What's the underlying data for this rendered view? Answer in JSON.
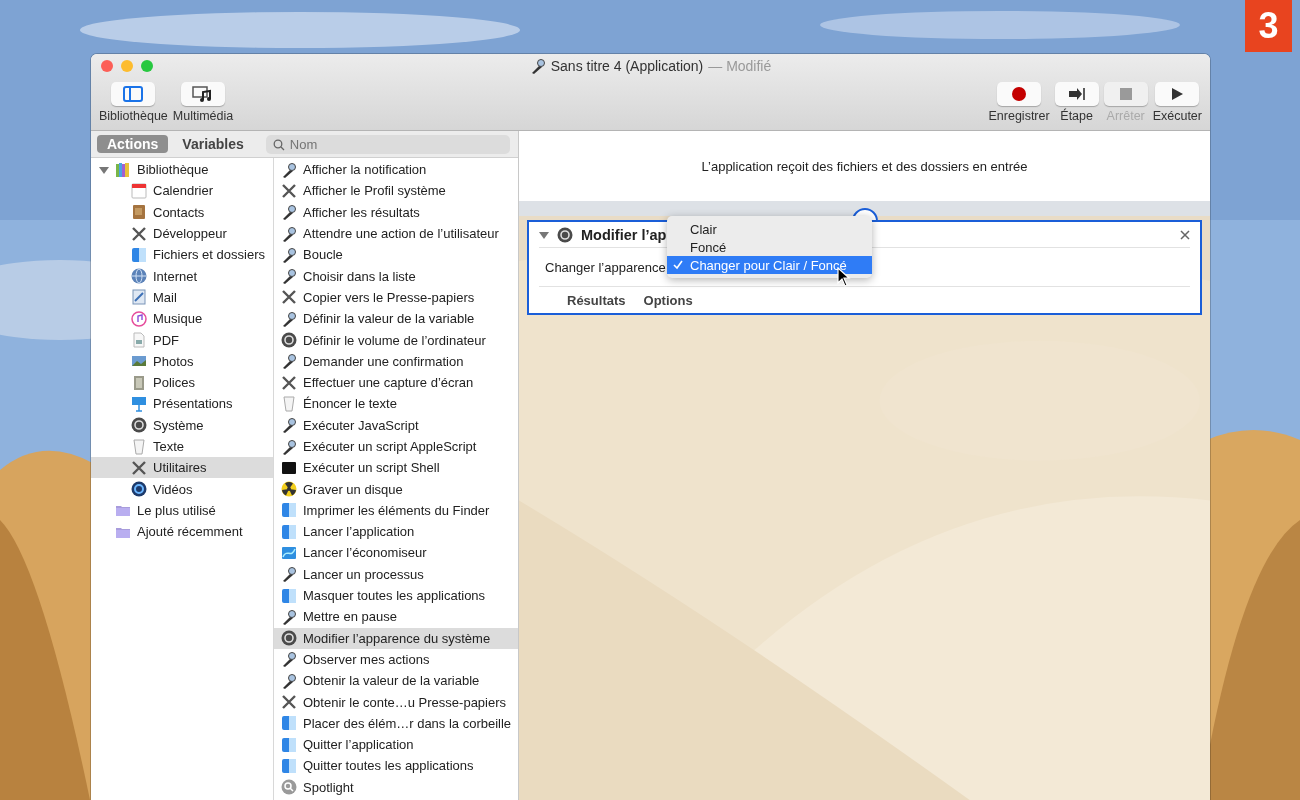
{
  "window": {
    "title": "Sans titre 4 (Application)",
    "title_status": "— Modifié"
  },
  "badge": "3",
  "toolbar_left": [
    {
      "label": "Bibliothèque",
      "kind": "sidebar"
    },
    {
      "label": "Multimédia",
      "kind": "media"
    }
  ],
  "toolbar_right": [
    {
      "label": "Enregistrer",
      "kind": "record",
      "disabled": false
    },
    {
      "label": "Étape",
      "kind": "step",
      "disabled": false
    },
    {
      "label": "Arrêter",
      "kind": "stop",
      "disabled": true
    },
    {
      "label": "Exécuter",
      "kind": "run",
      "disabled": false
    }
  ],
  "tabs": [
    {
      "label": "Actions",
      "selected": true
    },
    {
      "label": "Variables",
      "selected": false
    }
  ],
  "search": {
    "placeholder": "Nom"
  },
  "library": [
    {
      "label": "Bibliothèque",
      "kind": "library",
      "expanded": true,
      "selected": false,
      "children": [
        {
          "label": "Calendrier",
          "kind": "calendar",
          "selected": false
        },
        {
          "label": "Contacts",
          "kind": "contacts",
          "selected": false
        },
        {
          "label": "Développeur",
          "kind": "tools",
          "selected": false
        },
        {
          "label": "Fichiers et dossiers",
          "kind": "finder",
          "selected": false
        },
        {
          "label": "Internet",
          "kind": "internet",
          "selected": false
        },
        {
          "label": "Mail",
          "kind": "mail",
          "selected": false
        },
        {
          "label": "Musique",
          "kind": "music",
          "selected": false
        },
        {
          "label": "PDF",
          "kind": "pdf",
          "selected": false
        },
        {
          "label": "Photos",
          "kind": "photos",
          "selected": false
        },
        {
          "label": "Polices",
          "kind": "fonts",
          "selected": false
        },
        {
          "label": "Présentations",
          "kind": "presentation",
          "selected": false
        },
        {
          "label": "Système",
          "kind": "system",
          "selected": false
        },
        {
          "label": "Texte",
          "kind": "text",
          "selected": false
        },
        {
          "label": "Utilitaires",
          "kind": "tools",
          "selected": true
        },
        {
          "label": "Vidéos",
          "kind": "video",
          "selected": false
        }
      ]
    },
    {
      "label": "Le plus utilisé",
      "kind": "smartfolder",
      "selected": false
    },
    {
      "label": "Ajouté récemment",
      "kind": "smartfolder",
      "selected": false
    }
  ],
  "actions": [
    {
      "label": "Afficher la notification",
      "kind": "automator",
      "selected": false
    },
    {
      "label": "Afficher le Profil système",
      "kind": "tools",
      "selected": false
    },
    {
      "label": "Afficher les résultats",
      "kind": "automator",
      "selected": false
    },
    {
      "label": "Attendre une action de l’utilisateur",
      "kind": "automator",
      "selected": false
    },
    {
      "label": "Boucle",
      "kind": "automator",
      "selected": false
    },
    {
      "label": "Choisir dans la liste",
      "kind": "automator",
      "selected": false
    },
    {
      "label": "Copier vers le Presse-papiers",
      "kind": "tools",
      "selected": false
    },
    {
      "label": "Définir la valeur de la variable",
      "kind": "automator",
      "selected": false
    },
    {
      "label": "Définir le volume de l’ordinateur",
      "kind": "system",
      "selected": false
    },
    {
      "label": "Demander une confirmation",
      "kind": "automator",
      "selected": false
    },
    {
      "label": "Effectuer une capture d’écran",
      "kind": "tools",
      "selected": false
    },
    {
      "label": "Énoncer le texte",
      "kind": "text",
      "selected": false
    },
    {
      "label": "Exécuter JavaScript",
      "kind": "automator",
      "selected": false
    },
    {
      "label": "Exécuter un script AppleScript",
      "kind": "automator",
      "selected": false
    },
    {
      "label": "Exécuter un script Shell",
      "kind": "terminal",
      "selected": false
    },
    {
      "label": "Graver un disque",
      "kind": "burn",
      "selected": false
    },
    {
      "label": "Imprimer les éléments du Finder",
      "kind": "finder",
      "selected": false
    },
    {
      "label": "Lancer l’application",
      "kind": "finder",
      "selected": false
    },
    {
      "label": "Lancer l’économiseur",
      "kind": "screensaver",
      "selected": false
    },
    {
      "label": "Lancer un processus",
      "kind": "automator",
      "selected": false
    },
    {
      "label": "Masquer toutes les applications",
      "kind": "finder",
      "selected": false
    },
    {
      "label": "Mettre en pause",
      "kind": "automator",
      "selected": false
    },
    {
      "label": "Modifier l’apparence du système",
      "kind": "system",
      "selected": true
    },
    {
      "label": "Observer mes actions",
      "kind": "automator",
      "selected": false
    },
    {
      "label": "Obtenir la valeur de la variable",
      "kind": "automator",
      "selected": false
    },
    {
      "label": "Obtenir le conte…u Presse-papiers",
      "kind": "tools",
      "selected": false
    },
    {
      "label": "Placer des élém…r dans la corbeille",
      "kind": "finder",
      "selected": false
    },
    {
      "label": "Quitter l’application",
      "kind": "finder",
      "selected": false
    },
    {
      "label": "Quitter toutes les applications",
      "kind": "finder",
      "selected": false
    },
    {
      "label": "Spotlight",
      "kind": "spotlight",
      "selected": false
    }
  ],
  "workflow": {
    "input_description": "L’application reçoit des fichiers et des dossiers en entrée",
    "action": {
      "title": "Modifier l’ap",
      "kind": "system",
      "expanded": true,
      "label": "Changer l’apparence",
      "tabs": [
        "Résultats",
        "Options"
      ]
    },
    "menu": [
      {
        "label": "Clair",
        "selected": false
      },
      {
        "label": "Foncé",
        "selected": false
      },
      {
        "label": "Changer pour Clair / Foncé",
        "selected": true
      }
    ]
  }
}
